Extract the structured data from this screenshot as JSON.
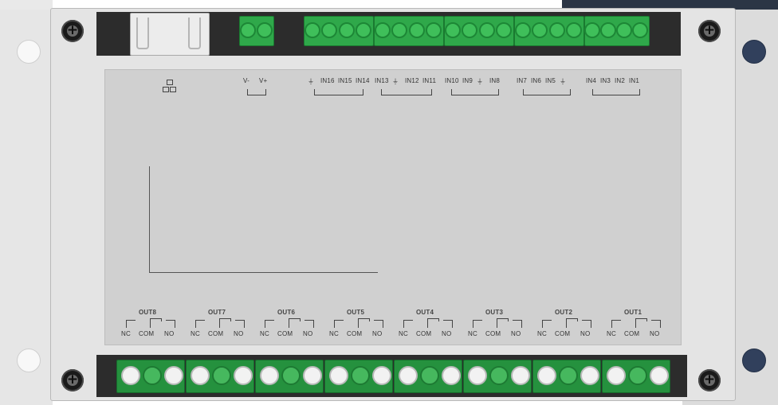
{
  "device": {
    "power_labels": [
      "V-",
      "V+"
    ],
    "inputs": [
      {
        "group": [
          "⏚",
          "IN16",
          "IN15",
          "IN14"
        ]
      },
      {
        "group": [
          "IN13",
          "⏚",
          "IN12",
          "IN11"
        ]
      },
      {
        "group": [
          "IN10",
          "IN9",
          "⏚",
          "IN8"
        ]
      },
      {
        "group": [
          "IN7",
          "IN6",
          "IN5",
          "⏚"
        ]
      },
      {
        "group": [
          "IN4",
          "IN3",
          "IN2",
          "IN1"
        ]
      }
    ],
    "outputs": [
      {
        "name": "OUT8",
        "nc": "NC",
        "com": "COM",
        "no": "NO"
      },
      {
        "name": "OUT7",
        "nc": "NC",
        "com": "COM",
        "no": "NO"
      },
      {
        "name": "OUT6",
        "nc": "NC",
        "com": "COM",
        "no": "NO"
      },
      {
        "name": "OUT5",
        "nc": "NC",
        "com": "COM",
        "no": "NO"
      },
      {
        "name": "OUT4",
        "nc": "NC",
        "com": "COM",
        "no": "NO"
      },
      {
        "name": "OUT3",
        "nc": "NC",
        "com": "COM",
        "no": "NO"
      },
      {
        "name": "OUT2",
        "nc": "NC",
        "com": "COM",
        "no": "NO"
      },
      {
        "name": "OUT1",
        "nc": "NC",
        "com": "COM",
        "no": "NO"
      }
    ]
  },
  "colors": {
    "terminal_green": "#2fa84a",
    "enclosure": "#e4e4e4",
    "label_panel": "#d0d0d0",
    "mount_accent": "#31405c"
  },
  "icons": [
    "network-icon",
    "ground-icon",
    "screw-icon",
    "relay-contact-icon",
    "ethernet-port-icon"
  ]
}
